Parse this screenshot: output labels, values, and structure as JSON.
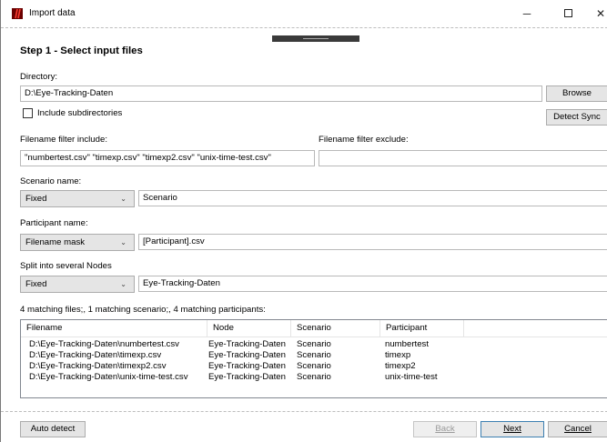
{
  "window": {
    "title": "Import data",
    "minimize_glyph": "─",
    "close_glyph": "✕"
  },
  "step_title": "Step 1 - Select input files",
  "directory": {
    "label": "Directory:",
    "value": "D:\\Eye-Tracking-Daten",
    "browse_label": "Browse",
    "include_subdirs_label": "Include subdirectories",
    "include_subdirs_checked": false,
    "detect_sync_label": "Detect Sync"
  },
  "filters": {
    "include_label": "Filename filter include:",
    "include_value": "\"numbertest.csv\" \"timexp.csv\" \"timexp2.csv\" \"unix-time-test.csv\"",
    "exclude_label": "Filename filter exclude:",
    "exclude_value": ""
  },
  "scenario": {
    "label": "Scenario name:",
    "mode": "Fixed",
    "value": "Scenario"
  },
  "participant": {
    "label": "Participant name:",
    "mode": "Filename mask",
    "value": "[Participant].csv"
  },
  "nodes": {
    "label": "Split into several Nodes",
    "mode": "Fixed",
    "value": "Eye-Tracking-Daten"
  },
  "summary": "4 matching files;, 1 matching scenario;, 4 matching participants:",
  "table": {
    "columns": [
      "Filename",
      "Node",
      "Scenario",
      "Participant"
    ],
    "rows": [
      [
        "D:\\Eye-Tracking-Daten\\numbertest.csv",
        "Eye-Tracking-Daten",
        "Scenario",
        "numbertest"
      ],
      [
        "D:\\Eye-Tracking-Daten\\timexp.csv",
        "Eye-Tracking-Daten",
        "Scenario",
        "timexp"
      ],
      [
        "D:\\Eye-Tracking-Daten\\timexp2.csv",
        "Eye-Tracking-Daten",
        "Scenario",
        "timexp2"
      ],
      [
        "D:\\Eye-Tracking-Daten\\unix-time-test.csv",
        "Eye-Tracking-Daten",
        "Scenario",
        "unix-time-test"
      ]
    ]
  },
  "footer": {
    "auto_detect_label": "Auto detect",
    "back_label": "Back",
    "next_label": "Next",
    "cancel_label": "Cancel"
  },
  "icons": {
    "app": "app-logo-icon",
    "chevron": "chevron-down-icon"
  },
  "colors": {
    "app_icon_bg": "#6b0000",
    "app_icon_stripes": "#ff3b2f",
    "default_button_border": "#3c7fb1"
  }
}
